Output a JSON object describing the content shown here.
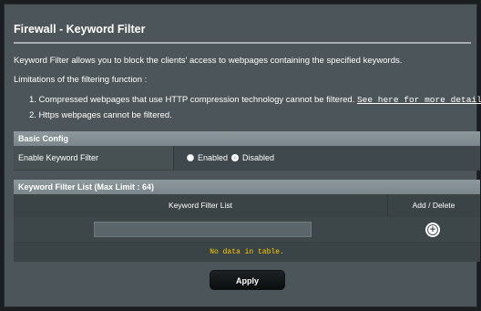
{
  "page": {
    "title": "Firewall - Keyword Filter",
    "description": "Keyword Filter allows you to block the clients' access to webpages containing the specified keywords.",
    "limitations_heading": "Limitations of the filtering function :",
    "limitation_1": "1. Compressed webpages that use HTTP compression technology cannot be filtered.",
    "limitation_1_link": "See here for more details.",
    "limitation_2": "2. Https webpages cannot be filtered."
  },
  "basic_config": {
    "heading": "Basic Config",
    "enable_label": "Enable Keyword Filter",
    "option_enabled": "Enabled",
    "option_disabled": "Disabled",
    "selected": "Disabled"
  },
  "filter_list": {
    "heading": "Keyword Filter List (Max Limit : 64)",
    "col_keyword": "Keyword Filter List",
    "col_add_delete": "Add / Delete",
    "input_value": "",
    "empty_message": "No data in table."
  },
  "actions": {
    "apply_label": "Apply"
  }
}
